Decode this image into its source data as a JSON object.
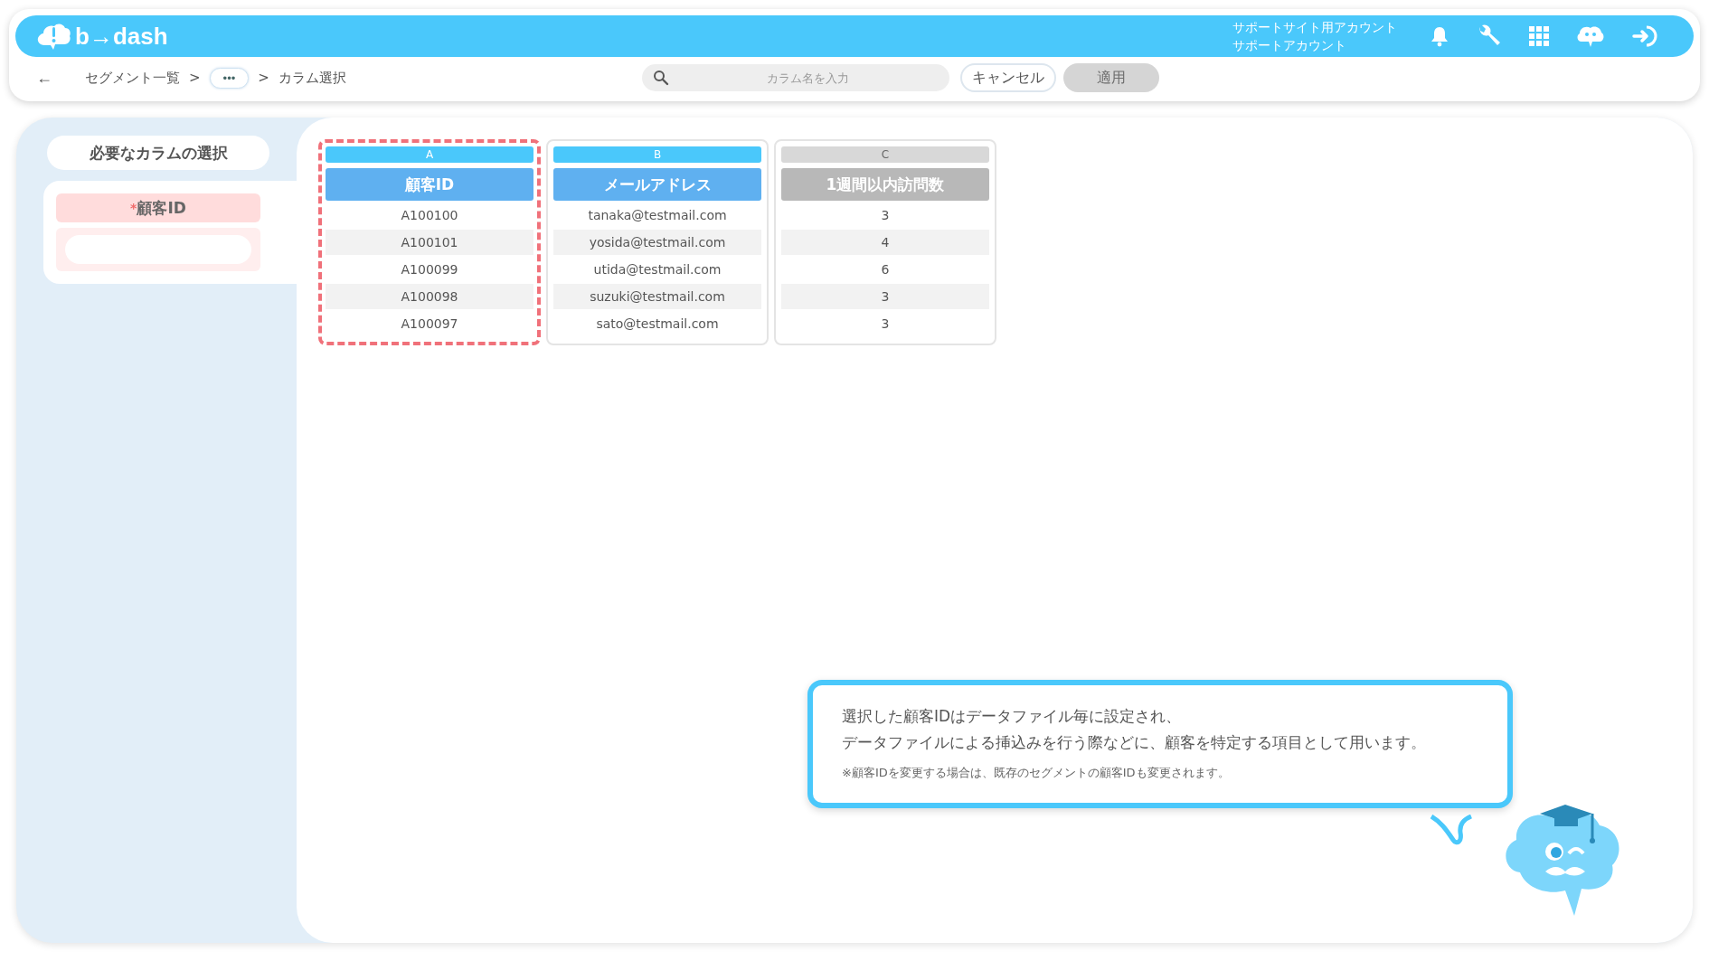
{
  "header": {
    "logo": "b→dash",
    "account": {
      "site": "サポートサイト用アカウント",
      "name": "サポートアカウント"
    }
  },
  "toolbar": {
    "back": "←",
    "breadcrumb": [
      {
        "kind": "link",
        "label": "セグメント一覧"
      },
      {
        "kind": "separator",
        "label": ">"
      },
      {
        "kind": "more",
        "label": "•••"
      },
      {
        "kind": "separator",
        "label": ">"
      },
      {
        "kind": "current",
        "label": "カラム選択"
      }
    ],
    "search": {
      "placeholder": "カラム名を入力"
    },
    "buttons": [
      {
        "label": "キャンセル",
        "disabled": false
      },
      {
        "label": "適用",
        "disabled": true
      }
    ]
  },
  "sidebar": {
    "title": "必要なカラムの選択",
    "fields": [
      {
        "required_mark": "*",
        "label": "顧客ID"
      }
    ]
  },
  "columns": [
    {
      "letter": "A",
      "name": "顧客ID",
      "selected": true,
      "disabled": false,
      "cells": [
        "A100100",
        "A100101",
        "A100099",
        "A100098",
        "A100097"
      ]
    },
    {
      "letter": "B",
      "name": "メールアドレス",
      "selected": false,
      "disabled": false,
      "cells": [
        "tanaka@testmail.com",
        "yosida@testmail.com",
        "utida@testmail.com",
        "suzuki@testmail.com",
        "sato@testmail.com"
      ]
    },
    {
      "letter": "C",
      "name": "1週間以内訪問数",
      "selected": false,
      "disabled": true,
      "cells": [
        "3",
        "4",
        "6",
        "3",
        "3"
      ]
    }
  ],
  "help": {
    "lines": [
      "選択した顧客IDはデータファイル毎に設定され、",
      "データファイルによる挿込みを行う際などに、顧客を特定する項目として用います。"
    ],
    "note": "※顧客IDを変更する場合は、既存のセグメントの顧客IDも変更されます。"
  }
}
